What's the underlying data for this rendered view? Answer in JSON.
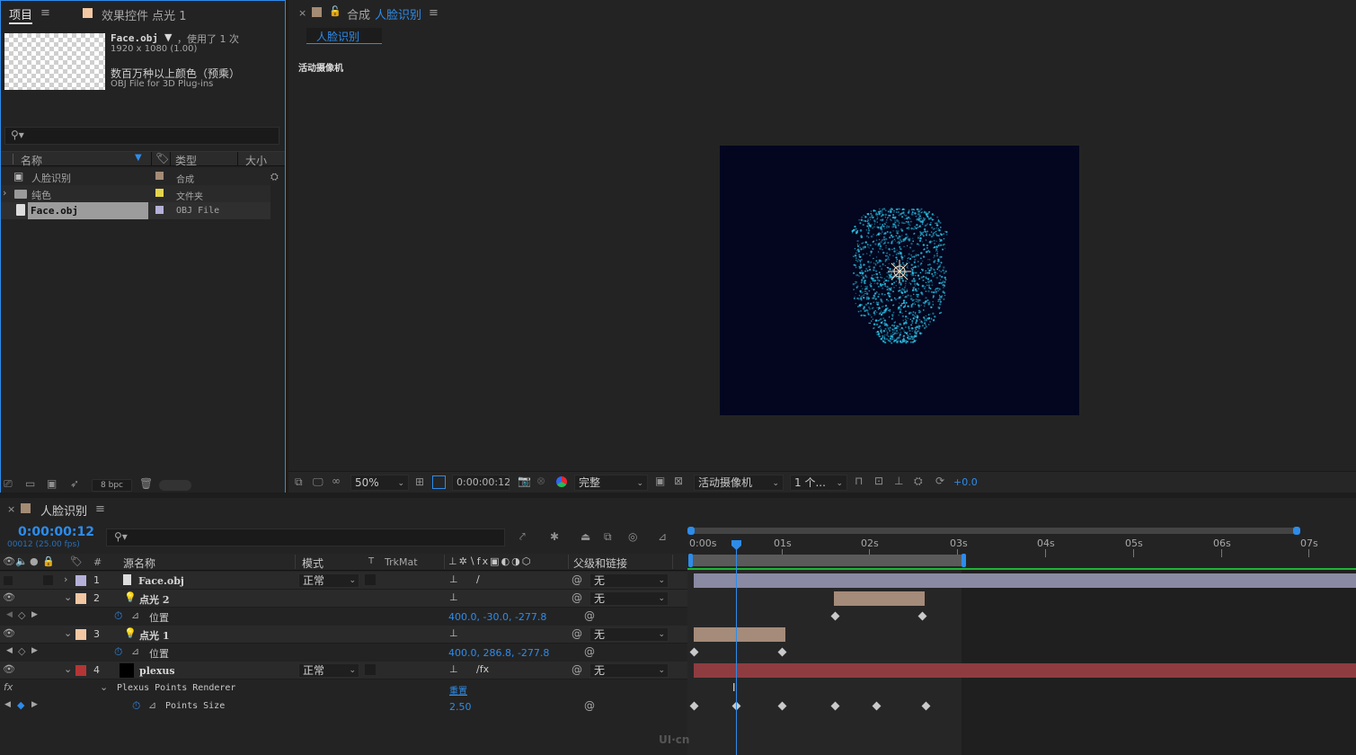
{
  "project_panel": {
    "tab_project": "项目",
    "tab_effects": "效果控件 点光 1",
    "selected_item": {
      "name": "Face.obj",
      "usage": "，使用了 1 次",
      "dimensions": "1920 x 1080 (1.00)",
      "color_depth": "数百万种以上颜色（预乘）",
      "file_type": "OBJ File for 3D Plug-ins"
    },
    "columns": {
      "name": "名称",
      "type": "类型",
      "size": "大小"
    },
    "items": [
      {
        "name": "人脸识别",
        "type": "合成",
        "label_color": "#a48b74",
        "icon": "composition-icon"
      },
      {
        "name": "纯色",
        "type": "文件夹",
        "label_color": "#e5d44b",
        "icon": "folder-icon"
      },
      {
        "name": "Face.obj",
        "type": "OBJ File",
        "label_color": "#b4b0d8",
        "icon": "file-icon"
      }
    ],
    "bpc": "8 bpc"
  },
  "comp_panel": {
    "tab_prefix": "合成",
    "tab_comp_name": "人脸识别",
    "sub_tab": "人脸识别",
    "camera_label": "活动摄像机",
    "toolbar": {
      "zoom": "50%",
      "timecode": "0:00:00:12",
      "resolution": "完整",
      "camera": "活动摄像机",
      "views": "1 个...",
      "exposure": "+0.0"
    },
    "bg_color": "#03061e",
    "point_color": "#2cc3e8"
  },
  "timeline": {
    "tab_name": "人脸识别",
    "timecode": "0:00:00:12",
    "frame_info": "00012 (25.00 fps)",
    "headers": {
      "num": "#",
      "source_name": "源名称",
      "mode": "模式",
      "t": "T",
      "trkmat": "TrkMat",
      "parent": "父级和链接"
    },
    "ruler": [
      "0:00s",
      "01s",
      "02s",
      "03s",
      "04s",
      "05s",
      "06s",
      "07s"
    ],
    "layers": [
      {
        "num": "1",
        "name": "Face.obj",
        "mode": "正常",
        "parent": "无",
        "label_color": "#b4b0d8",
        "bar_color": "#8a8aa3"
      },
      {
        "num": "2",
        "name": "点光 2",
        "parent": "无",
        "label_color": "#f2c7a2",
        "bar_color": "#a58b79",
        "prop": {
          "name": "位置",
          "value": "400.0, -30.0, -277.8"
        }
      },
      {
        "num": "3",
        "name": "点光 1",
        "parent": "无",
        "label_color": "#f2c7a2",
        "bar_color": "#a58b79",
        "prop": {
          "name": "位置",
          "value": "400.0, 286.8, -277.8"
        }
      },
      {
        "num": "4",
        "name": "plexus",
        "mode": "正常",
        "parent": "无",
        "label_color": "#b43535",
        "bar_color": "#8f3c40",
        "effect": {
          "name": "Plexus Points Renderer",
          "reset": "重置"
        },
        "prop": {
          "name": "Points Size",
          "value": "2.50"
        }
      }
    ],
    "fx_label": "fx",
    "watermark": "UI·cn"
  }
}
